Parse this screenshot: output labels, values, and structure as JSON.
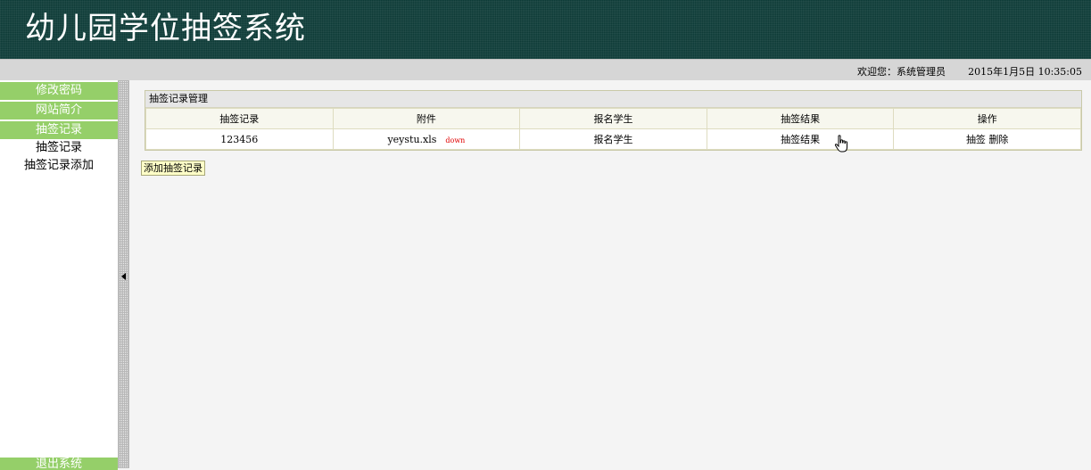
{
  "header": {
    "title": "幼儿园学位抽签系统"
  },
  "infobar": {
    "welcome": "欢迎您：系统管理员",
    "datetime": "2015年1月5日  10:35:05"
  },
  "sidebar": {
    "menu_change_password": "修改密码",
    "menu_site_intro": "网站简介",
    "menu_lottery_records": "抽签记录",
    "sub_lottery_records": "抽签记录",
    "sub_add_lottery_record": "抽签记录添加",
    "menu_logout": "退出系统"
  },
  "panel": {
    "title": "抽签记录管理",
    "columns": [
      "抽签记录",
      "附件",
      "报名学生",
      "抽签结果",
      "操作"
    ],
    "rows": [
      {
        "record": "123456",
        "attachment": "yeystu.xls",
        "download": "down",
        "students": "报名学生",
        "result": "抽签结果",
        "action_draw": "抽签",
        "action_delete": "删除"
      }
    ]
  },
  "add_button": "添加抽签记录",
  "colors": {
    "header_bg": "#0d3b37",
    "menu_green": "#95cf69",
    "download_red": "#e00000",
    "button_yellow": "#ffffc8"
  }
}
